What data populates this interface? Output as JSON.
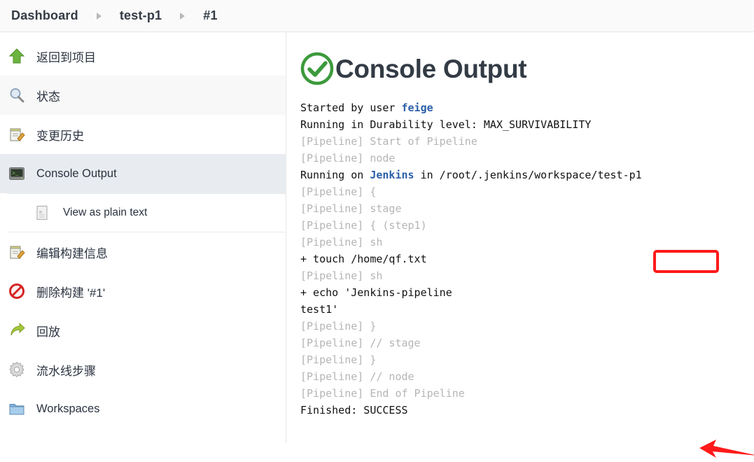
{
  "breadcrumb": {
    "items": [
      {
        "label": "Dashboard"
      },
      {
        "label": "test-p1"
      },
      {
        "label": "#1"
      }
    ]
  },
  "sidebar": {
    "items": [
      {
        "label": "返回到项目",
        "icon": "green-up-arrow-icon",
        "name": "back-to-project"
      },
      {
        "label": "状态",
        "icon": "magnifier-icon",
        "name": "status"
      },
      {
        "label": "变更历史",
        "icon": "notepad-pencil-icon",
        "name": "changes"
      },
      {
        "label": "Console Output",
        "icon": "terminal-icon",
        "name": "console-output"
      },
      {
        "label": "View as plain text",
        "icon": "document-icon",
        "name": "view-as-plain-text"
      },
      {
        "label": "编辑构建信息",
        "icon": "notepad-pencil-icon",
        "name": "edit-build-information"
      },
      {
        "label": "删除构建 '#1'",
        "icon": "no-entry-icon",
        "name": "delete-build"
      },
      {
        "label": "回放",
        "icon": "green-redo-arrow-icon",
        "name": "replay"
      },
      {
        "label": "流水线步骤",
        "icon": "gear-icon",
        "name": "pipeline-steps"
      },
      {
        "label": "Workspaces",
        "icon": "folder-icon",
        "name": "workspaces"
      }
    ]
  },
  "main": {
    "title": "Console Output",
    "status_icon": "check-circle-icon",
    "console_lines": [
      {
        "segments": [
          {
            "text": "Started by user ",
            "style": "plain"
          },
          {
            "text": "feige",
            "style": "link"
          }
        ]
      },
      {
        "segments": [
          {
            "text": "Running in Durability level: MAX_SURVIVABILITY",
            "style": "plain"
          }
        ]
      },
      {
        "segments": [
          {
            "text": "[Pipeline] Start of Pipeline",
            "style": "pipe"
          }
        ]
      },
      {
        "segments": [
          {
            "text": "[Pipeline] node",
            "style": "pipe"
          }
        ]
      },
      {
        "segments": [
          {
            "text": "Running on ",
            "style": "plain"
          },
          {
            "text": "Jenkins",
            "style": "link"
          },
          {
            "text": " in /root/.jenkins/workspace/test-p1",
            "style": "plain"
          }
        ]
      },
      {
        "segments": [
          {
            "text": "[Pipeline] {",
            "style": "pipe"
          }
        ]
      },
      {
        "segments": [
          {
            "text": "[Pipeline] stage",
            "style": "pipe"
          }
        ]
      },
      {
        "segments": [
          {
            "text": "[Pipeline] { (step1)",
            "style": "pipe"
          }
        ]
      },
      {
        "segments": [
          {
            "text": "[Pipeline] sh",
            "style": "pipe"
          }
        ]
      },
      {
        "segments": [
          {
            "text": "+ touch /home/qf.txt",
            "style": "plain"
          }
        ]
      },
      {
        "segments": [
          {
            "text": "[Pipeline] sh",
            "style": "pipe"
          }
        ]
      },
      {
        "segments": [
          {
            "text": "+ echo 'Jenkins-pipeline",
            "style": "plain"
          }
        ]
      },
      {
        "segments": [
          {
            "text": "test1'",
            "style": "plain"
          }
        ]
      },
      {
        "segments": [
          {
            "text": "[Pipeline] }",
            "style": "pipe"
          }
        ]
      },
      {
        "segments": [
          {
            "text": "[Pipeline] // stage",
            "style": "pipe"
          }
        ]
      },
      {
        "segments": [
          {
            "text": "[Pipeline] }",
            "style": "pipe"
          }
        ]
      },
      {
        "segments": [
          {
            "text": "[Pipeline] // node",
            "style": "pipe"
          }
        ]
      },
      {
        "segments": [
          {
            "text": "[Pipeline] End of Pipeline",
            "style": "pipe"
          }
        ]
      },
      {
        "segments": [
          {
            "text": "Finished: SUCCESS",
            "style": "plain"
          }
        ]
      }
    ]
  },
  "annotations": {
    "highlight_box_target": "{ (step1)",
    "arrow_target": "Finished: SUCCESS",
    "color": "#ff1a1a"
  },
  "colors": {
    "success_green": "#3c9a3c",
    "link_blue": "#2b5fa8",
    "active_row": "#e8ecf0",
    "pipeline_grey": "#b5b5b5"
  }
}
